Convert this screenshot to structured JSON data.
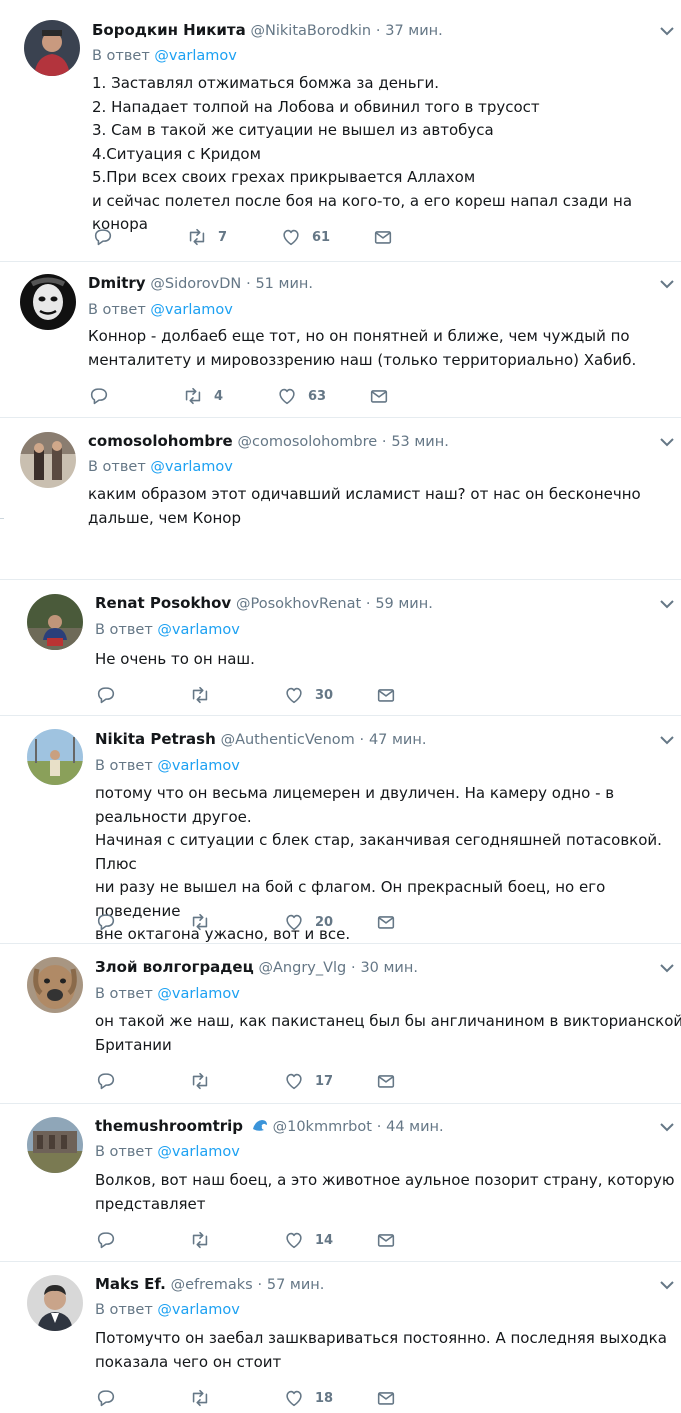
{
  "accent": "#1da1f2",
  "muted": "#657786",
  "tweets": [
    {
      "name": "Бородкин Никита",
      "handle": "@NikitaBorodkin",
      "sep": "·",
      "time": "37 мин.",
      "reply_prefix": "В ответ",
      "reply_to": "@varlamov",
      "text": "1. Заставлял отжиматься бомжа за деньги.\n2. Нападает толпой на Лобова и обвинил того в трусост\n3. Сам в такой же ситуации не вышел из автобуса\n4.Ситуация с Кридом\n5.При всех своих грехах прикрывается Аллахом\nи сейчас полетел после боя на кого-то, а его кореш напал сзади на конора",
      "retweets": "7",
      "likes": "61"
    },
    {
      "name": "Dmitry",
      "handle": "@SidorovDN",
      "sep": "·",
      "time": "51 мин.",
      "reply_prefix": "В ответ",
      "reply_to": "@varlamov",
      "text": "Коннор - долбаеб еще тот, но он понятней и ближе, чем чуждый по\nменталитету и мировоззрению наш (только территориально) Хабиб.",
      "retweets": "4",
      "likes": "63"
    },
    {
      "name": "comosolohombre",
      "handle": "@comosolohombre",
      "sep": "·",
      "time": "53 мин.",
      "reply_prefix": "В ответ",
      "reply_to": "@varlamov",
      "text": "каким образом этот одичавший исламист наш? от нас он бесконечно\nдальше, чем Конор",
      "retweets": "",
      "likes": ""
    },
    {
      "name": "Renat Posokhov",
      "handle": "@PosokhovRenat",
      "sep": "·",
      "time": "59 мин.",
      "reply_prefix": "В ответ",
      "reply_to": "@varlamov",
      "text": "Не очень то он наш.",
      "retweets": "",
      "likes": "30"
    },
    {
      "name": "Nikita Petrash",
      "handle": "@AuthenticVenom",
      "sep": "·",
      "time": "47 мин.",
      "reply_prefix": "В ответ",
      "reply_to": "@varlamov",
      "text": "потому что он весьма лицемерен и двуличен. На камеру одно - в\nреальности другое.\nНачиная с ситуации с блек стар, заканчивая сегодняшней потасовкой. Плюс\nни разу не вышел на бой с флагом. Он прекрасный боец, но его поведение\nвне октагона ужасно, вот и все.",
      "retweets": "",
      "likes": "20"
    },
    {
      "name": "Злой волгоградец",
      "handle": "@Angry_Vlg",
      "sep": "·",
      "time": "30 мин.",
      "reply_prefix": "В ответ",
      "reply_to": "@varlamov",
      "text": "он такой же наш, как пакистанец был бы англичанином в викторианской\nБритании",
      "retweets": "",
      "likes": "17"
    },
    {
      "name": "themushroomtrip",
      "handle": "@10kmmrbot",
      "sep": "·",
      "time": "44 мин.",
      "reply_prefix": "В ответ",
      "reply_to": "@varlamov",
      "text": "Волков, вот наш боец, а это животное аульное позорит страну, которую\nпредставляет",
      "retweets": "",
      "likes": "14"
    },
    {
      "name": "Maks Ef.",
      "handle": "@efremaks",
      "sep": "·",
      "time": "57 мин.",
      "reply_prefix": "В ответ",
      "reply_to": "@varlamov",
      "text": "Потомучто он заебал зашквариваться постоянно. А последняя выходка\nпоказала чего он стоит",
      "retweets": "",
      "likes": "18"
    }
  ]
}
